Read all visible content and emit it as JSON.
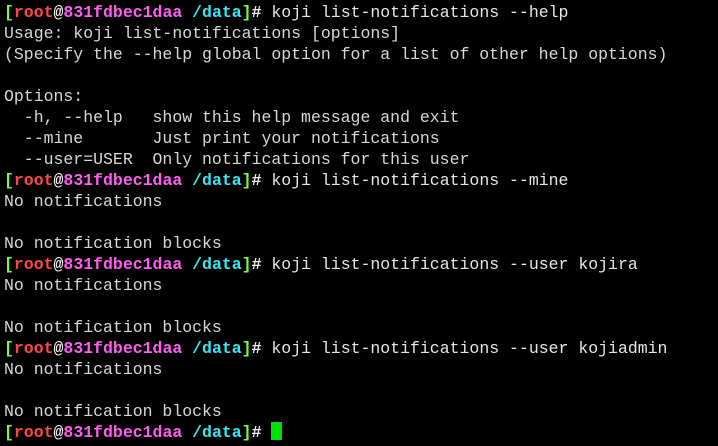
{
  "terminal": {
    "prompt": {
      "open": "[",
      "user": "root",
      "at": "@",
      "host": "831fdbec1daa",
      "cwd": "/data",
      "close": "]#"
    },
    "lines": [
      {
        "type": "prompt",
        "command": " koji list-notifications --help"
      },
      {
        "type": "output",
        "text": "Usage: koji list-notifications [options]"
      },
      {
        "type": "output",
        "text": "(Specify the --help global option for a list of other help options)"
      },
      {
        "type": "output",
        "text": ""
      },
      {
        "type": "output",
        "text": "Options:"
      },
      {
        "type": "output",
        "text": "  -h, --help   show this help message and exit"
      },
      {
        "type": "output",
        "text": "  --mine       Just print your notifications"
      },
      {
        "type": "output",
        "text": "  --user=USER  Only notifications for this user"
      },
      {
        "type": "prompt",
        "command": " koji list-notifications --mine"
      },
      {
        "type": "output",
        "text": "No notifications"
      },
      {
        "type": "output",
        "text": ""
      },
      {
        "type": "output",
        "text": "No notification blocks"
      },
      {
        "type": "prompt",
        "command": " koji list-notifications --user kojira"
      },
      {
        "type": "output",
        "text": "No notifications"
      },
      {
        "type": "output",
        "text": ""
      },
      {
        "type": "output",
        "text": "No notification blocks"
      },
      {
        "type": "prompt",
        "command": " koji list-notifications --user kojiadmin"
      },
      {
        "type": "output",
        "text": "No notifications"
      },
      {
        "type": "output",
        "text": ""
      },
      {
        "type": "output",
        "text": "No notification blocks"
      },
      {
        "type": "prompt",
        "command": " ",
        "cursor": true
      }
    ],
    "colors": {
      "background": "#000000",
      "foreground": "#d8d8d8",
      "bracket": "#7cfc3a",
      "user": "#ff4646",
      "host": "#ff5cf0",
      "cwd": "#3ae6f0",
      "cursor": "#00e000"
    }
  }
}
